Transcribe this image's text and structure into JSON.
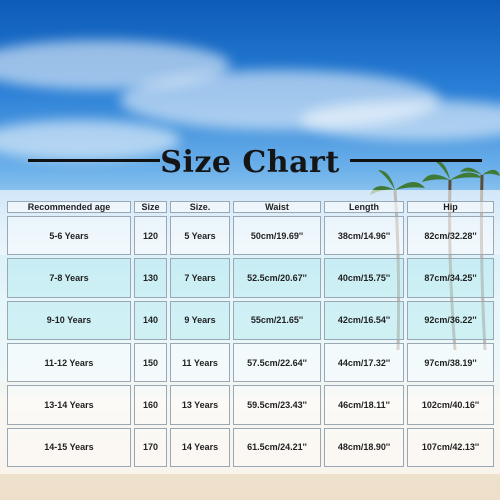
{
  "title": "Size Chart",
  "columns": [
    "Recommended age",
    "Size",
    "Size.",
    "Waist",
    "Length",
    "Hip"
  ],
  "rows": [
    [
      "5-6 Years",
      "120",
      "5 Years",
      "50cm/19.69''",
      "38cm/14.96''",
      "82cm/32.28''"
    ],
    [
      "7-8 Years",
      "130",
      "7 Years",
      "52.5cm/20.67''",
      "40cm/15.75''",
      "87cm/34.25''"
    ],
    [
      "9-10 Years",
      "140",
      "9 Years",
      "55cm/21.65''",
      "42cm/16.54''",
      "92cm/36.22''"
    ],
    [
      "11-12 Years",
      "150",
      "11 Years",
      "57.5cm/22.64''",
      "44cm/17.32''",
      "97cm/38.19''"
    ],
    [
      "13-14 Years",
      "160",
      "13 Years",
      "59.5cm/23.43''",
      "46cm/18.11''",
      "102cm/40.16''"
    ],
    [
      "14-15 Years",
      "170",
      "14 Years",
      "61.5cm/24.21''",
      "48cm/18.90''",
      "107cm/42.13''"
    ]
  ]
}
